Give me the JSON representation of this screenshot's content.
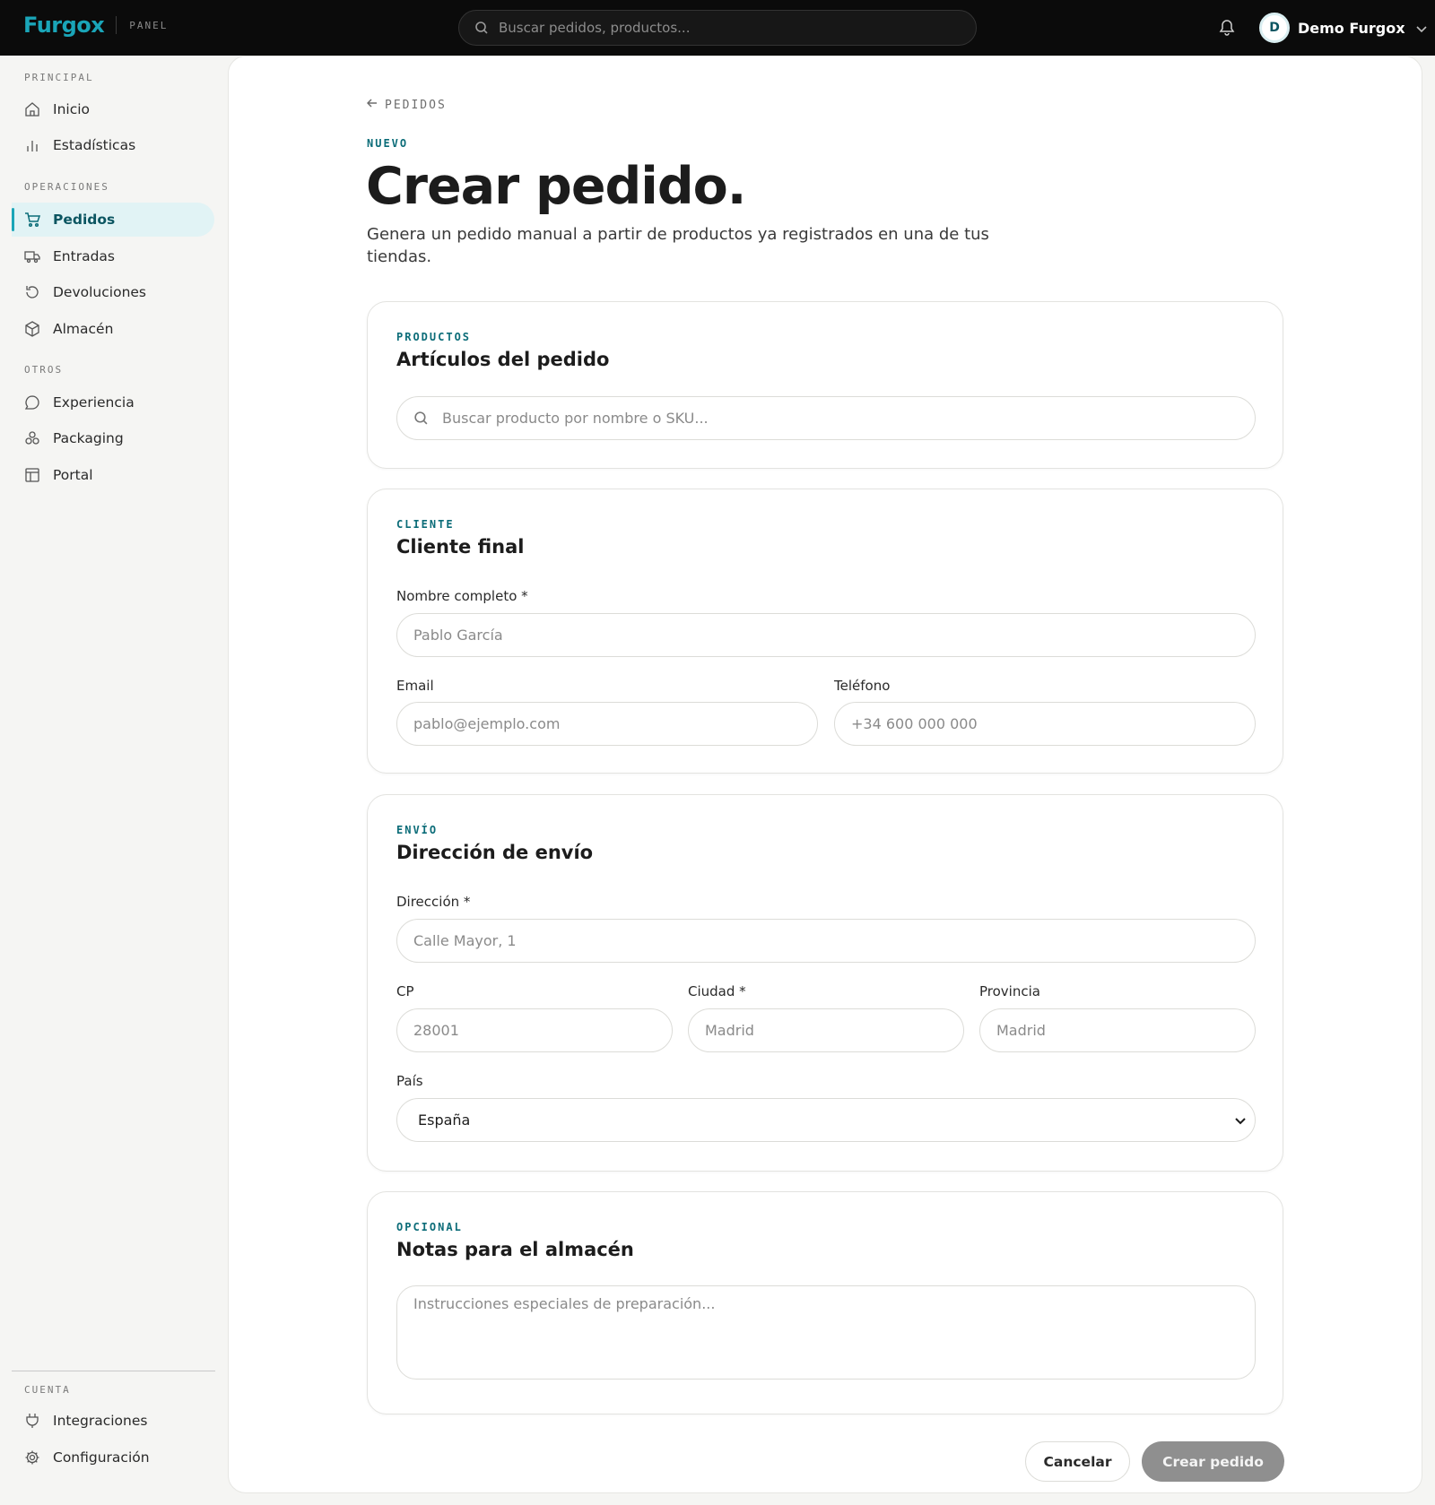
{
  "topbar": {
    "brand": "Furgox",
    "brand_tag": "PANEL",
    "search_placeholder": "Buscar pedidos, productos...",
    "user": {
      "initial": "D",
      "name": "Demo Furgox"
    }
  },
  "sidebar": {
    "sections": [
      {
        "title": "PRINCIPAL",
        "items": [
          {
            "label": "Inicio",
            "icon": "home-icon"
          },
          {
            "label": "Estadísticas",
            "icon": "bar-chart-icon"
          }
        ]
      },
      {
        "title": "OPERACIONES",
        "items": [
          {
            "label": "Pedidos",
            "icon": "cart-icon",
            "active": true
          },
          {
            "label": "Entradas",
            "icon": "truck-icon"
          },
          {
            "label": "Devoluciones",
            "icon": "return-icon"
          },
          {
            "label": "Almacén",
            "icon": "box-icon"
          }
        ]
      },
      {
        "title": "OTROS",
        "items": [
          {
            "label": "Experiencia",
            "icon": "chat-icon"
          },
          {
            "label": "Packaging",
            "icon": "packages-icon"
          },
          {
            "label": "Portal",
            "icon": "layout-icon"
          }
        ]
      },
      {
        "title": "CUENTA",
        "items": [
          {
            "label": "Integraciones",
            "icon": "plug-icon"
          },
          {
            "label": "Configuración",
            "icon": "gear-icon"
          }
        ]
      }
    ]
  },
  "page": {
    "back_label": "PEDIDOS",
    "eyebrow": "NUEVO",
    "title": "Crear pedido.",
    "description": "Genera un pedido manual a partir de productos ya registrados en una de tus tiendas."
  },
  "products": {
    "eyebrow": "PRODUCTOS",
    "title": "Artículos del pedido",
    "search_placeholder": "Buscar producto por nombre o SKU..."
  },
  "customer": {
    "eyebrow": "CLIENTE",
    "title": "Cliente final",
    "name_label": "Nombre completo *",
    "name_placeholder": "Pablo García",
    "email_label": "Email",
    "email_placeholder": "pablo@ejemplo.com",
    "phone_label": "Teléfono",
    "phone_placeholder": "+34 600 000 000"
  },
  "shipping": {
    "eyebrow": "ENVÍO",
    "title": "Dirección de envío",
    "address_label": "Dirección *",
    "address_placeholder": "Calle Mayor, 1",
    "zip_label": "CP",
    "zip_placeholder": "28001",
    "city_label": "Ciudad *",
    "city_placeholder": "Madrid",
    "province_label": "Provincia",
    "province_placeholder": "Madrid",
    "country_label": "País",
    "country_value": "España"
  },
  "notes": {
    "eyebrow": "OPCIONAL",
    "title": "Notas para el almacén",
    "placeholder": "Instrucciones especiales de preparación..."
  },
  "actions": {
    "cancel": "Cancelar",
    "create": "Crear pedido"
  },
  "colors": {
    "accent": "#1aa5b8",
    "accent_dark": "#0b6c78",
    "topbar_bg": "#0b0b0b",
    "active_nav_bg": "#e1f3f5",
    "disabled_button": "#8f8f8f"
  }
}
